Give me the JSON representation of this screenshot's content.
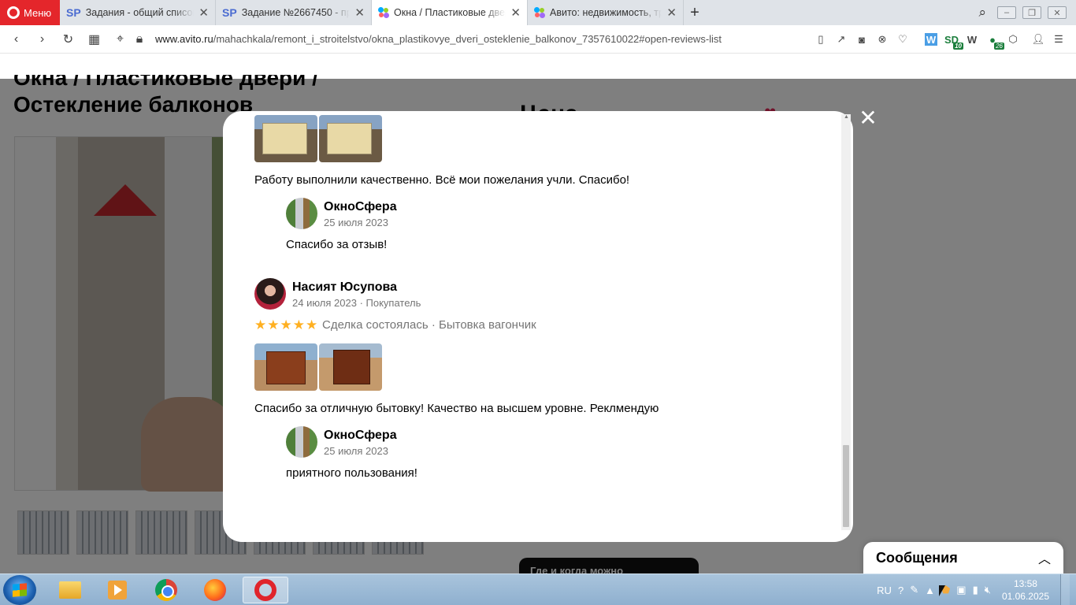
{
  "browser": {
    "menu_label": "Меню",
    "tabs": [
      {
        "title": "Задания - общий список з",
        "favicon": "sp-icon"
      },
      {
        "title": "Задание №2667450 - прос",
        "favicon": "sp-icon"
      },
      {
        "title": "Окна / Пластиковые двер",
        "favicon": "avito-icon",
        "active": true
      },
      {
        "title": "Авито: недвижимость, тра",
        "favicon": "avito-icon"
      }
    ],
    "url_host": "www.avito.ru",
    "url_path": "/mahachkala/remont_i_stroitelstvo/okna_plastikovye_dveri_osteklenie_balkonov_7357610022#open-reviews-list",
    "extension_badges": {
      "sd": "10",
      "kz": "26"
    }
  },
  "page": {
    "title_line1": "Окна / Пластиковые двери /",
    "title_line2": "Остекление балконов",
    "price_partial": "Цена",
    "where_button": "Где и когда можно посмотреть?"
  },
  "reviews": [
    {
      "text": "Работу выполнили качественно. Всё мои пожелания учли. Спасибо!",
      "reply": {
        "name": "ОкноСфера",
        "date": "25 июля 2023",
        "text": "Спасибо за отзыв!"
      }
    },
    {
      "author": "Насият Юсупова",
      "meta": "24 июля 2023 · Покупатель",
      "rating": 5,
      "deal": "Сделка состоялась · Бытовка вагончик",
      "text": "Спасибо за отличную бытовку! Качество на высшем уровне. Реклмендую",
      "reply": {
        "name": "ОкноСфера",
        "date": "25 июля 2023",
        "text": "приятного пользования!"
      }
    }
  ],
  "messages_panel": {
    "title": "Сообщения"
  },
  "taskbar": {
    "lang": "RU",
    "time": "13:58",
    "date": "01.06.2025"
  },
  "colors": {
    "accent_red": "#e4262b",
    "star": "#ffb021",
    "meta_gray": "#757575"
  }
}
